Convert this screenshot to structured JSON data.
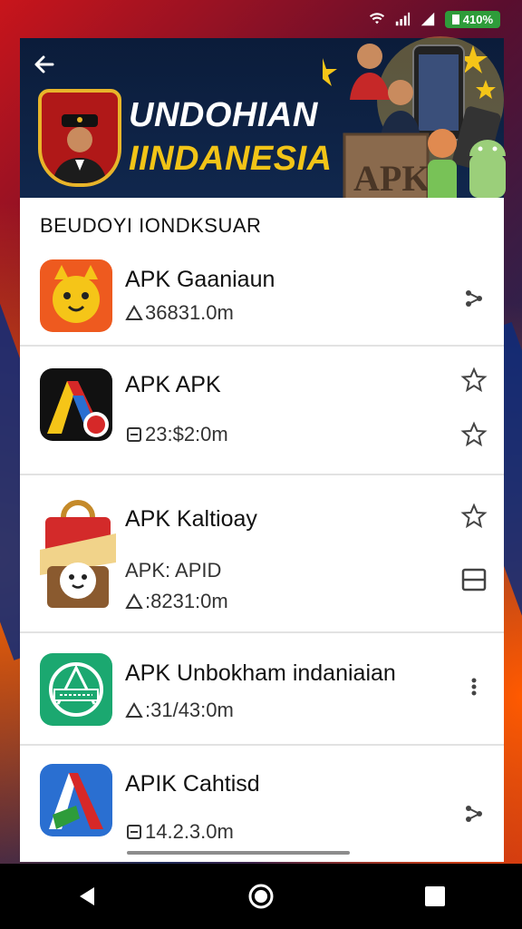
{
  "status_bar": {
    "battery": "410%"
  },
  "header": {
    "title_line1": "UNDOHIAN",
    "title_line2": "IINDANESIA",
    "promo_sign": "APK"
  },
  "section_title": "BEUDOYI IONDKSUAR",
  "apps": [
    {
      "name": "APK Gaaniaun",
      "size": "36831.0m",
      "icon": "cat-face-icon",
      "icon_color": "#ee5a1f",
      "action_icon": "share-icon"
    },
    {
      "name": "APK APK",
      "size": "23:$2:0m",
      "icon": "red-yellow-a-icon",
      "icon_color": "#111111",
      "action_icons": [
        "star-icon",
        "star-icon"
      ]
    },
    {
      "name": "APK Kaltioay",
      "sub": "APK: APID",
      "size": ":8231:0m",
      "icon": "shopping-bag-icon",
      "icon_color": "#d32a2a",
      "action_icons": [
        "star-icon",
        "minus-box-icon"
      ]
    },
    {
      "name": "APK  Unbokham indaniaian",
      "size": ":31/43:0m",
      "icon": "green-badge-icon",
      "icon_color": "#1ba870",
      "action_icon": "more-icon"
    },
    {
      "name": "APIK Cahtisd",
      "size": "14.2.3.0m",
      "icon": "blue-red-a-icon",
      "icon_color": "#2a6fd1",
      "action_icon": "share-icon"
    }
  ],
  "nav": [
    "back-nav-icon",
    "home-nav-icon",
    "recents-nav-icon"
  ]
}
